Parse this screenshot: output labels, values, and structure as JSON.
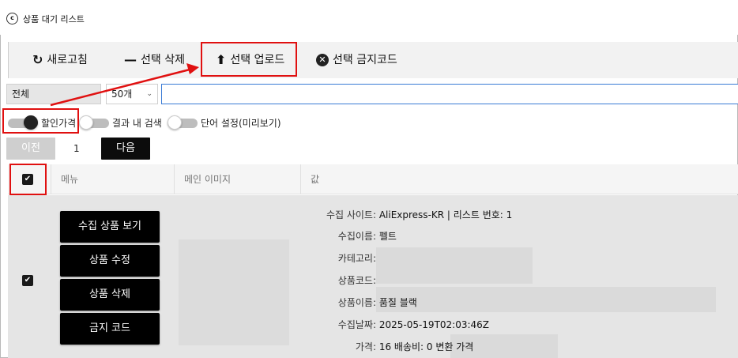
{
  "window": {
    "title": "상품 대기 리스트",
    "app_icon": "coupang-logo-icon"
  },
  "toolbar": {
    "refresh_label": "새로고침",
    "delete_label": "선택 삭제",
    "upload_label": "선택 업로드",
    "ban_label": "선택 금지코드"
  },
  "filters": {
    "category_selected": "전체",
    "count_selected": "50개",
    "search_value": ""
  },
  "toggles": {
    "discount_label": "할인가격",
    "discount_on": true,
    "results_label": "결과 내 검색",
    "results_on": false,
    "word_label": "단어 설정(미리보기)",
    "word_on": false
  },
  "pagination": {
    "prev_label": "이전",
    "page": "1",
    "next_label": "다음"
  },
  "table": {
    "header_checked": true,
    "columns": [
      "메뉴",
      "메인 이미지",
      "값"
    ],
    "rows": [
      {
        "checked": true,
        "actions": [
          "수집 상품 보기",
          "상품 수정",
          "상품 삭제",
          "금지 코드"
        ],
        "fields": [
          {
            "label": "수집 사이트:",
            "value": "AliExpress-KR | 리스트 번호: 1"
          },
          {
            "label": "수집이름:",
            "value": "펠트"
          },
          {
            "label": "카테고리:",
            "value": ""
          },
          {
            "label": "상품코드:",
            "value": ""
          },
          {
            "label": "상품이름:",
            "value": "품질 블랙"
          },
          {
            "label": "수집날짜:",
            "value": "2025-05-19T02:03:46Z"
          },
          {
            "label": "가격:",
            "value": "16 배송비: 0 변환 가격"
          }
        ]
      }
    ]
  },
  "colors": {
    "highlight": "#e01010",
    "accent": "#3a7bd5",
    "button_dark": "#000000"
  }
}
